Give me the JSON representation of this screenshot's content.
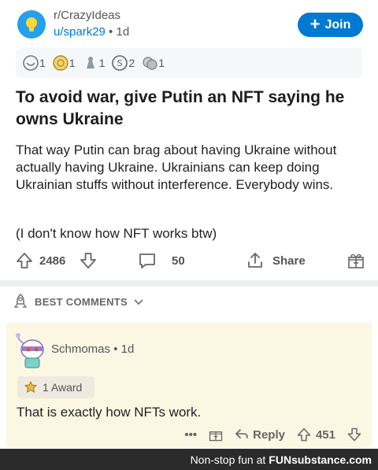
{
  "post": {
    "subreddit": "r/CrazyIdeas",
    "author": "u/spark29",
    "separator": "•",
    "age": "1d",
    "join_label": "Join",
    "awards": [
      {
        "icon": "wholesome-award-icon",
        "count": "1"
      },
      {
        "icon": "helpful-award-icon",
        "count": "1"
      },
      {
        "icon": "silver-award-icon",
        "count": "1"
      },
      {
        "icon": "snoo-award-icon",
        "count": "2"
      },
      {
        "icon": "wearing-is-caring-icon",
        "count": "1"
      }
    ],
    "title": "To avoid war, give Putin an NFT saying he owns Ukraine",
    "body": "That way Putin can brag about having Ukraine without actually having Ukraine. Ukrainians can keep doing Ukrainian stuffs without interference. Everybody wins.",
    "body_note": "(I don't know how NFT works btw)",
    "votes": "2486",
    "comments": "50",
    "share_label": "Share"
  },
  "sort": {
    "label": "BEST COMMENTS"
  },
  "comment": {
    "author": "Schmomas",
    "separator": "•",
    "age": "1d",
    "award_label": "1 Award",
    "text": "That is exactly how NFTs work.",
    "more": "•••",
    "reply_label": "Reply",
    "votes": "451"
  },
  "footer": {
    "tagline": "Non-stop fun at",
    "brand": "FUNsubstance.com"
  },
  "colors": {
    "accent": "#0079d3",
    "comment_bg": "#fcf7e3",
    "footer_bg": "#2b2b2b"
  }
}
